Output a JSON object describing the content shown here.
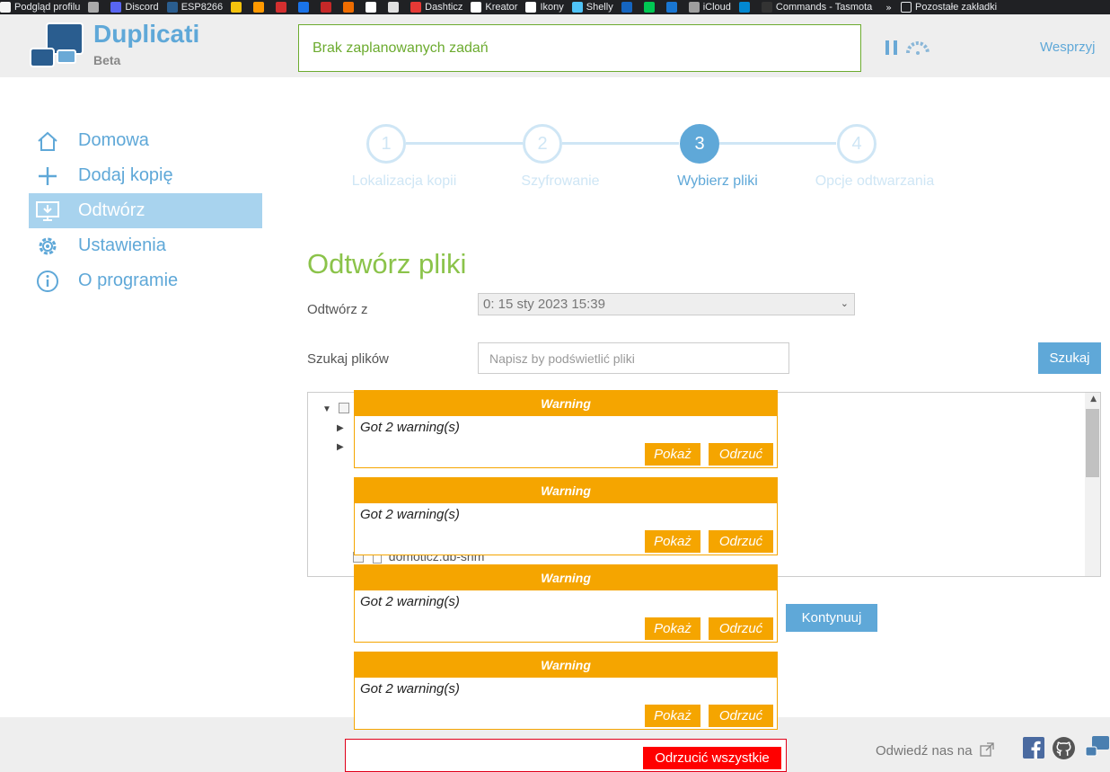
{
  "bookmarks": [
    {
      "label": "Podgląd profilu",
      "color": "#f5f5f5"
    },
    {
      "label": "",
      "color": "#aaaaaa"
    },
    {
      "label": "Discord",
      "color": "#5865f2"
    },
    {
      "label": "ESP8266",
      "color": "#2a5d8f"
    },
    {
      "label": "",
      "color": "#f4c20d"
    },
    {
      "label": "",
      "color": "#ff9900"
    },
    {
      "label": "",
      "color": "#d32f2f"
    },
    {
      "label": "",
      "color": "#1a73e8"
    },
    {
      "label": "",
      "color": "#c62828"
    },
    {
      "label": "",
      "color": "#ef6c00"
    },
    {
      "label": "",
      "color": "#ffffff"
    },
    {
      "label": "",
      "color": "#e0e0e0"
    },
    {
      "label": "Dashticz",
      "color": "#e53935"
    },
    {
      "label": "Kreator",
      "color": "#ffffff"
    },
    {
      "label": "Ikony",
      "color": "#ffffff"
    },
    {
      "label": "Shelly",
      "color": "#4fc3f7"
    },
    {
      "label": "",
      "color": "#1565c0"
    },
    {
      "label": "",
      "color": "#00c853"
    },
    {
      "label": "",
      "color": "#1976d2"
    },
    {
      "label": "iCloud",
      "color": "#9e9e9e"
    },
    {
      "label": "",
      "color": "#0288d1"
    },
    {
      "label": "Commands - Tasmota",
      "color": "#333333"
    }
  ],
  "bookmarks_other": "Pozostałe zakładki",
  "app": {
    "name": "Duplicati",
    "edition": "Beta"
  },
  "status_text": "Brak zaplanowanych zadań",
  "donate": "Wesprzyj",
  "sidebar": {
    "items": [
      {
        "label": "Domowa",
        "icon": "home-icon"
      },
      {
        "label": "Dodaj kopię",
        "icon": "plus-icon"
      },
      {
        "label": "Odtwórz",
        "icon": "restore-icon"
      },
      {
        "label": "Ustawienia",
        "icon": "gear-icon"
      },
      {
        "label": "O programie",
        "icon": "info-icon"
      }
    ],
    "active_index": 2
  },
  "steps": [
    {
      "number": "1",
      "label": "Lokalizacja kopii"
    },
    {
      "number": "2",
      "label": "Szyfrowanie"
    },
    {
      "number": "3",
      "label": "Wybierz pliki"
    },
    {
      "number": "4",
      "label": "Opcje odtwarzania"
    }
  ],
  "active_step": 3,
  "main": {
    "title": "Odtwórz pliki",
    "restore_from_label": "Odtwórz z",
    "restore_from_value": "0: 15 sty 2023 15:39",
    "search_label": "Szukaj plików",
    "search_placeholder": "Napisz by podświetlić pliki",
    "search_button": "Szukaj",
    "continue_button": "Kontynuuj",
    "visible_file": "domoticz.db-shm"
  },
  "warnings": [
    {
      "title": "Warning",
      "message": "Got 2 warning(s)",
      "show": "Pokaż",
      "dismiss": "Odrzuć"
    },
    {
      "title": "Warning",
      "message": "Got 2 warning(s)",
      "show": "Pokaż",
      "dismiss": "Odrzuć"
    },
    {
      "title": "Warning",
      "message": "Got 2 warning(s)",
      "show": "Pokaż",
      "dismiss": "Odrzuć"
    },
    {
      "title": "Warning",
      "message": "Got 2 warning(s)",
      "show": "Pokaż",
      "dismiss": "Odrzuć"
    }
  ],
  "dismiss_all": "Odrzucić wszystkie",
  "footer": {
    "visit": "Odwiedź nas na"
  },
  "colors": {
    "accent": "#5fa8d8",
    "green": "#8bc34a",
    "warning": "#f5a500",
    "danger": "#ff0000"
  }
}
